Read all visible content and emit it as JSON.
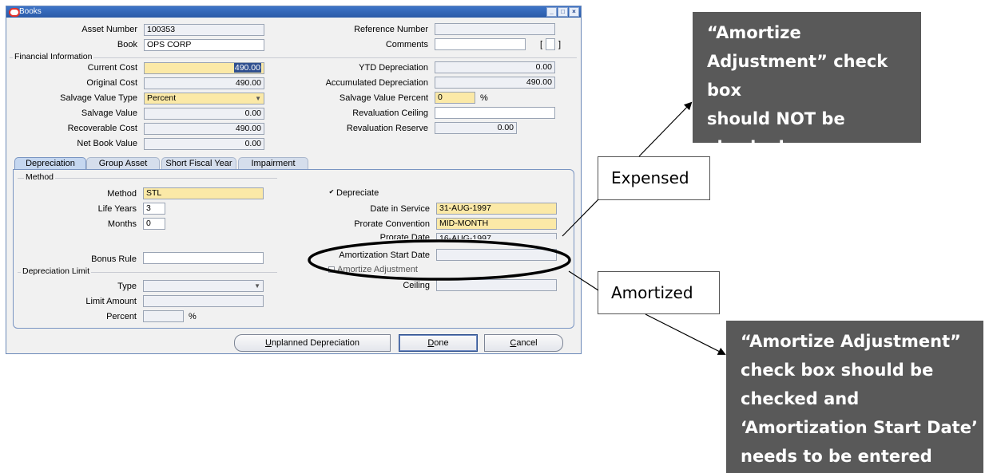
{
  "window": {
    "title": "Books",
    "logo": "oracle-logo-icon",
    "controls": [
      "minimize-icon",
      "maximize-icon",
      "close-icon"
    ]
  },
  "header": {
    "asset_number_label": "Asset Number",
    "asset_number": "100353",
    "book_label": "Book",
    "book": "OPS CORP",
    "reference_number_label": "Reference Number",
    "reference_number": "",
    "comments_label": "Comments",
    "comments": "",
    "bracket_open": "[",
    "bracket_close": "]"
  },
  "financial": {
    "section_title": "Financial Information",
    "current_cost_label": "Current Cost",
    "current_cost": "490.00",
    "original_cost_label": "Original Cost",
    "original_cost": "490.00",
    "salvage_value_type_label": "Salvage Value Type",
    "salvage_value_type": "Percent",
    "salvage_value_label": "Salvage Value",
    "salvage_value": "0.00",
    "recoverable_cost_label": "Recoverable Cost",
    "recoverable_cost": "490.00",
    "net_book_value_label": "Net Book Value",
    "net_book_value": "0.00",
    "ytd_depreciation_label": "YTD Depreciation",
    "ytd_depreciation": "0.00",
    "accumulated_depreciation_label": "Accumulated Depreciation",
    "accumulated_depreciation": "490.00",
    "salvage_value_percent_label": "Salvage Value Percent",
    "salvage_value_percent": "0",
    "percent_sign": "%",
    "revaluation_ceiling_label": "Revaluation Ceiling",
    "revaluation_ceiling": "",
    "revaluation_reserve_label": "Revaluation Reserve",
    "revaluation_reserve": "0.00"
  },
  "tabs": [
    {
      "label": "Depreciation",
      "active": true
    },
    {
      "label": "Group Asset",
      "active": false
    },
    {
      "label": "Short Fiscal Year",
      "active": false
    },
    {
      "label": "Impairment",
      "active": false
    }
  ],
  "depreciation": {
    "method_section": "Method",
    "method_label": "Method",
    "method": "STL",
    "life_years_label": "Life Years",
    "life_years": "3",
    "months_label": "Months",
    "months": "0",
    "bonus_rule_label": "Bonus Rule",
    "bonus_rule": "",
    "depreciate_label": "Depreciate",
    "depreciate_checked": "✔",
    "date_in_service_label": "Date in Service",
    "date_in_service": "31-AUG-1997",
    "prorate_convention_label": "Prorate Convention",
    "prorate_convention": "MID-MONTH",
    "prorate_date_label": "Prorate Date",
    "prorate_date": "16-AUG-1997",
    "amortization_start_date_label": "Amortization Start Date",
    "amortization_start_date": "",
    "amortize_adjustment_label": "Amortize Adjustment",
    "limit_section": "Depreciation Limit",
    "type_label": "Type",
    "type": "",
    "limit_amount_label": "Limit Amount",
    "limit_amount": "",
    "percent_label": "Percent",
    "percent": "",
    "percent_sign": "%",
    "ceiling_label": "Ceiling",
    "ceiling": ""
  },
  "buttons": {
    "unplanned_prefix": "U",
    "unplanned_rest": "nplanned Depreciation",
    "done_prefix": "D",
    "done_rest": "one",
    "cancel_prefix": "C",
    "cancel_rest": "ancel"
  },
  "annotations": {
    "top_callout": [
      "“Amortize",
      "Adjustment” check box",
      "should NOT be",
      "checked"
    ],
    "expensed": "Expensed",
    "amortized": "Amortized",
    "bottom_callout": [
      "“Amortize Adjustment”",
      "check box should be",
      "checked and",
      "‘Amortization Start Date’",
      "needs to be entered"
    ]
  },
  "colors": {
    "required_field": "#fbe9a7",
    "readonly_field": "#eef0f5",
    "titlebar": "#2a5aa7",
    "callout_dark": "#595959"
  }
}
